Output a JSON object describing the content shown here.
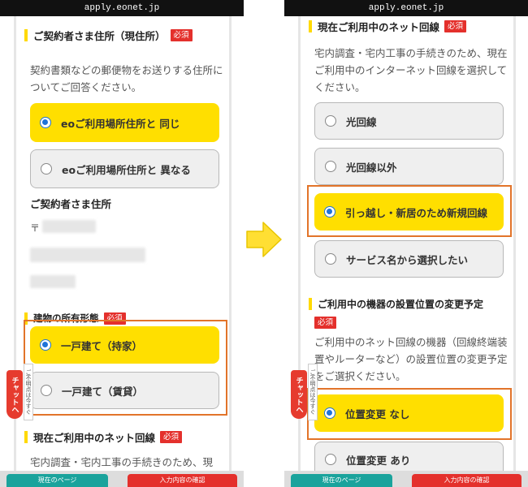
{
  "url": "apply.eonet.jp",
  "required_badge": "必須",
  "left_screen": {
    "section_address": {
      "title": "ご契約者さま住所（現住所）",
      "description": "契約書類などの郵便物をお送りする住所についてご回答ください。",
      "options": [
        "eoご利用場所住所と 同じ",
        "eoご利用場所住所と 異なる"
      ]
    },
    "address_label": "ご契約者さま住所",
    "postal_mark": "〒",
    "section_building": {
      "title": "建物の所有形態",
      "options": [
        "一戸建て（持家）",
        "一戸建て（賃貸）"
      ]
    },
    "section_network": {
      "title": "現在ご利用中のネット回線",
      "description": "宅内調査・宅内工事の手続きのため、現"
    },
    "chat_label": "チャットへ",
    "chat_note": "ご不明点は今すぐ",
    "bottom_buttons": [
      "現在のページ",
      "入力内容の確認"
    ]
  },
  "right_screen": {
    "section_network": {
      "title": "現在ご利用中のネット回線",
      "description": "宅内調査・宅内工事の手続きのため、現在ご利用中のインターネット回線を選択してください。",
      "options": [
        "光回線",
        "光回線以外",
        "引っ越し・新居のため新規回線",
        "サービス名から選択したい"
      ]
    },
    "section_equipment": {
      "title": "ご利用中の機器の設置位置の変更予定",
      "description": "ご利用中のネット回線の機器（回線終端装置やルーターなど）の設置位置の変更予定をご選択ください。",
      "options": [
        "位置変更 なし",
        "位置変更 あり"
      ]
    },
    "chat_label": "チャットへ",
    "chat_note": "ご不明点は今すぐ",
    "bottom_buttons": [
      "現在のページ",
      "入力内容の確認"
    ]
  },
  "colors": {
    "selected_option": "#ffdf00",
    "highlight_border": "#e2742a",
    "radio_selected": "#1e73d8",
    "required_badge": "#e4302c",
    "transition_arrow": "#ffdf33"
  },
  "icons": {
    "transition": "right-arrow-icon",
    "radio_on": "radio-selected-icon",
    "radio_off": "radio-unselected-icon"
  }
}
